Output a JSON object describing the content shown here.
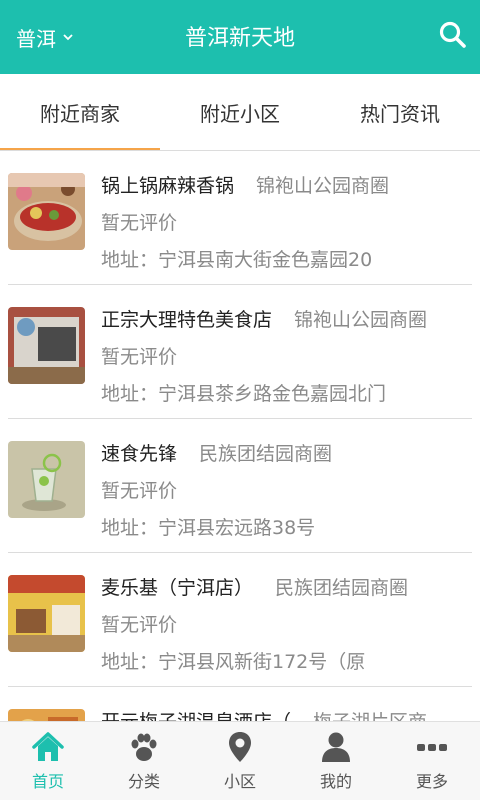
{
  "header": {
    "city": "普洱",
    "title": "普洱新天地",
    "icons": {
      "chevron": "chevron-down-icon",
      "search": "search-icon"
    }
  },
  "tabs": [
    {
      "label": "附近商家",
      "active": true
    },
    {
      "label": "附近小区",
      "active": false
    },
    {
      "label": "热门资讯",
      "active": false
    }
  ],
  "listings": [
    {
      "name": "锅上锅麻辣香锅",
      "area": "锦袍山公园商圈",
      "rating": "暂无评价",
      "address": "地址：宁洱县南大街金色嘉园20"
    },
    {
      "name": "正宗大理特色美食店",
      "area": "锦袍山公园商圈",
      "rating": "暂无评价",
      "address": "地址：宁洱县茶乡路金色嘉园北门"
    },
    {
      "name": "速食先锋",
      "area": "民族团结园商圈",
      "rating": "暂无评价",
      "address": "地址：宁洱县宏远路38号"
    },
    {
      "name": "麦乐基（宁洱店）",
      "area": "民族团结园商圈",
      "rating": "暂无评价",
      "address": "地址：宁洱县风新街172号（原"
    },
    {
      "name": "开元梅子湖温泉酒店（",
      "area": "梅子湖片区商",
      "rating": "",
      "address": ""
    }
  ],
  "bottom_nav": [
    {
      "label": "首页",
      "icon": "home-icon",
      "active": true
    },
    {
      "label": "分类",
      "icon": "paw-icon",
      "active": false
    },
    {
      "label": "小区",
      "icon": "location-pin-icon",
      "active": false
    },
    {
      "label": "我的",
      "icon": "user-icon",
      "active": false
    },
    {
      "label": "更多",
      "icon": "more-dots-icon",
      "active": false
    }
  ],
  "colors": {
    "accent": "#1dbfae",
    "tab_indicator": "#f5a44a"
  }
}
